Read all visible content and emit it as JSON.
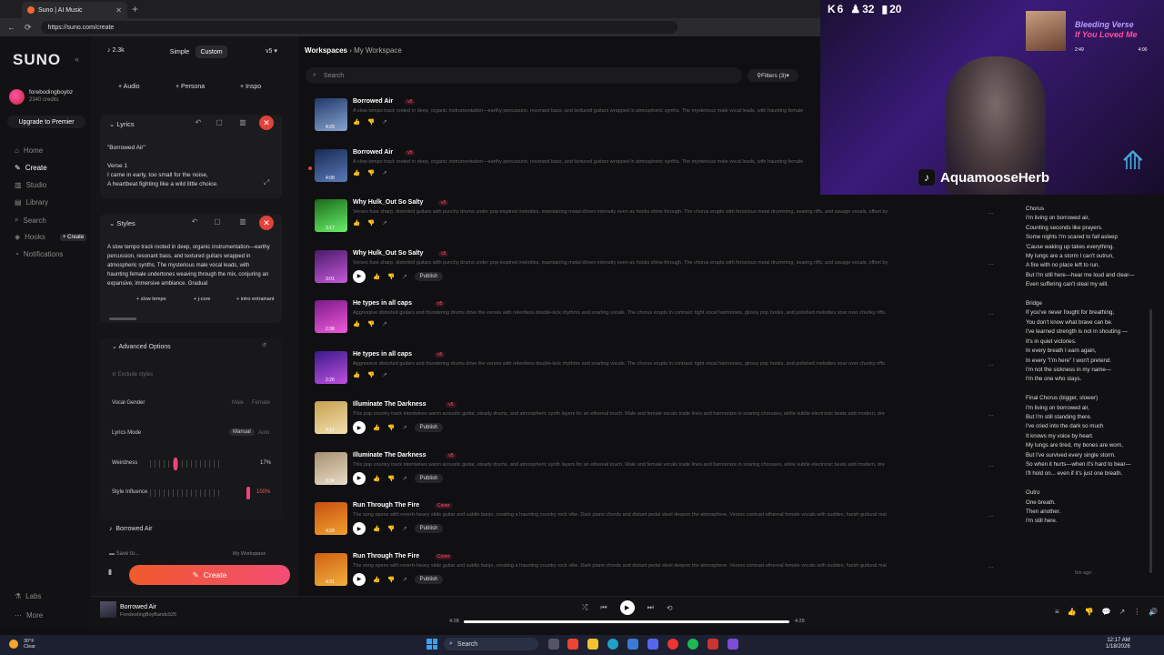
{
  "browser": {
    "tab_title": "Suno | AI Music",
    "url": "https://suno.com/create"
  },
  "nav": {
    "logo": "SUNO",
    "username": "forebodingboybz",
    "credits": "2340 credits",
    "upgrade": "Upgrade to Premier",
    "items": [
      "Home",
      "Create",
      "Studio",
      "Library",
      "Search",
      "Hooks",
      "Notifications"
    ],
    "create_tag": "+ Create",
    "bottom": [
      "Labs",
      "More"
    ]
  },
  "create": {
    "count": "2.3k",
    "modes": [
      "Simple",
      "Custom"
    ],
    "version": "v5",
    "add_buttons": [
      "+ Audio",
      "+ Persona",
      "+ Inspo"
    ],
    "lyrics_header": "Lyrics",
    "lyrics_text": "\"Borrowed Air\"\n\nVerse 1\nI came in early, too small for the noise,\nA heartbeat fighting like a wild little choice.",
    "styles_header": "Styles",
    "styles_text": "A slow tempo track rooted in deep, organic instrumentation—earthy percussion, resonant bass, and textured guitars wrapped in atmospheric synths. The mysterious male vocal leads, with haunting female undertones weaving through the mix, conjuring an expansive, immersive ambiance. Gradual",
    "style_chips": [
      "+ slow tempo",
      "+ j-core",
      "+ intro entrainant"
    ],
    "advanced": "Advanced Options",
    "exclude": "Exclude styles",
    "vocal_gender": "Vocal Gender",
    "vg_opts": [
      "Male",
      "Female"
    ],
    "lyrics_mode": "Lyrics Mode",
    "lm_opts": [
      "Manual",
      "Auto"
    ],
    "weirdness": "Weirdness",
    "weirdness_val": "17%",
    "weirdness_pct": 0.17,
    "style_influence": "Style Influence",
    "si_val": "100%",
    "si_pct": 1.0,
    "song_title": "Borrowed Air",
    "save_to": "Save to...",
    "workspace": "My Workspace",
    "create_btn": "Create"
  },
  "main": {
    "breadcrumb_root": "Workspaces",
    "breadcrumb_leaf": "My Workspace",
    "search_placeholder": "Search",
    "filters": "Filters (3)",
    "songs": [
      {
        "title": "Borrowed Air",
        "badge": "v5",
        "dur": "4:29",
        "desc": "A slow tempo track rooted in deep, organic instrumentation—earthy percussion, resonant bass, and textured guitars wrapped in atmospheric synths. The mysterious male vocal leads, with haunting female",
        "publish": false,
        "c1": "#1f3a6a",
        "c2": "#8aa4d0"
      },
      {
        "title": "Borrowed Air",
        "badge": "v5",
        "dur": "4:08",
        "desc": "A slow tempo track rooted in deep, organic instrumentation—earthy percussion, resonant bass, and textured guitars wrapped in atmospheric synths. The mysterious male vocal leads, with haunting female",
        "publish": false,
        "c1": "#182a52",
        "c2": "#5a7ab8"
      },
      {
        "title": "Why Hulk_Out So Salty",
        "badge": "v5",
        "dur": "3:17",
        "desc": "Verses fuse sharp, distorted guitars with punchy drums under pop-inspired melodies, maintaining metal-driven intensity even as hooks shine through. The chorus erupts with ferocious metal drumming, searing riffs, and savage vocals, offset by",
        "publish": false,
        "c1": "#1a6a1a",
        "c2": "#6af06a"
      },
      {
        "title": "Why Hulk_Out So Salty",
        "badge": "v5",
        "dur": "3:01",
        "desc": "Verses fuse sharp, distorted guitars with punchy drums under pop-inspired melodies, maintaining metal-driven intensity even as hooks shine through. The chorus erupts with ferocious metal drumming, searing riffs, and savage vocals, offset by",
        "publish": true,
        "c1": "#4a1a6a",
        "c2": "#c45ad8"
      },
      {
        "title": "He types in all caps",
        "badge": "v5",
        "dur": "2:38",
        "desc": "Aggressive distorted guitars and thundering drums drive the verses with relentless double-kick rhythms and snarling vocals. The chorus erupts in contrast: tight vocal harmonies, glossy pop hooks, and polished melodies soar over chunky riffs.",
        "publish": false,
        "c1": "#7a1a8a",
        "c2": "#f05ad8"
      },
      {
        "title": "He types in all caps",
        "badge": "v5",
        "dur": "2:26",
        "desc": "Aggressive distorted guitars and thundering drums drive the verses with relentless double-kick rhythms and snarling vocals. The chorus erupts in contrast: tight vocal harmonies, glossy pop hooks, and polished melodies soar over chunky riffs.",
        "publish": false,
        "c1": "#3a1a8a",
        "c2": "#c050e0"
      },
      {
        "title": "Illuminate The Darkness",
        "badge": "v5",
        "dur": "4:12",
        "desc": "This pop country track intertwines warm acoustic guitar, steady drums, and atmospheric synth layers for an ethereal touch. Male and female vocals trade lines and harmonize in soaring choruses, while subtle electronic beats add modern, dre",
        "publish": true,
        "c1": "#c8a050",
        "c2": "#f0e0b0"
      },
      {
        "title": "Illuminate The Darkness",
        "badge": "v5",
        "dur": "3:34",
        "desc": "This pop country track intertwines warm acoustic guitar, steady drums, and atmospheric synth layers for an ethereal touch. Male and female vocals trade lines and harmonize in soaring choruses, while subtle electronic beats add modern, dre",
        "publish": true,
        "c1": "#a89070",
        "c2": "#e8dcc8"
      },
      {
        "title": "Run Through The Fire",
        "badge": "Cover",
        "dur": "4:29",
        "desc": "The song opens with reverb-heavy slide guitar and subtle banjo, creating a haunting country rock vibe. Dark piano chords and distant pedal steel deepen the atmosphere. Verses contrast ethereal female vocals with sudden, harsh guttural mal",
        "publish": true,
        "c1": "#c85010",
        "c2": "#f0a030"
      },
      {
        "title": "Run Through The Fire",
        "badge": "Cover",
        "dur": "4:31",
        "desc": "The song opens with reverb-heavy slide guitar and subtle banjo, creating a haunting country rock vibe. Dark piano chords and distant pedal steel deepen the atmosphere. Verses contrast ethereal female vocals with sudden, harsh guttural mal",
        "publish": true,
        "c1": "#d06010",
        "c2": "#f0b040"
      }
    ],
    "publish_label": "Publish"
  },
  "lyrics_panel": {
    "text": "Chorus\nI'm living on borrowed air,\nCounting seconds like prayers.\nSome nights I'm scared to fall asleep\n'Cause waking up takes everything.\nMy lungs are a storm I can't outrun,\nA fire with no place left to run.\nBut I'm still here—hear me loud and clear—\nEven suffering can't steal my will.\n\nBridge\nIf you've never fought for breathing,\nYou don't know what brave can be.\nI've learned strength is not in shouting —\nIt's in quiet victories.\nIn every breath I earn again,\nIn every \"I'm here\" I won't pretend.\nI'm not the sickness in my name—\nI'm the one who stays.\n\nFinal Chorus (bigger, slower)\nI'm living on borrowed air,\nBut I'm still standing there.\nI've cried into the dark so much\nIt knows my voice by heart.\nMy lungs are tired, my bones are worn,\nBut I've survived every single storm.\nSo when it hurts—when it's hard to bear—\nI'll hold on... even if it's just one breath.\n\nOutro\nOne breath.\nThen another.\nI'm still here.",
    "time": "5m ago"
  },
  "stream": {
    "stat1": "6",
    "stat2": "32",
    "stat3": "20",
    "now_title": "Bleeding Verse",
    "now_sub": "If You Loved Me",
    "now_t1": "2:49",
    "now_t2": "4:00",
    "handle": "AquamooseHerb"
  },
  "player": {
    "title": "Borrowed Air",
    "artist": "ForebodingBoyBands925",
    "t1": "4:28",
    "t2": "4:29"
  },
  "taskbar": {
    "weather_temp": "30°F",
    "weather_cond": "Clear",
    "search": "Search",
    "time": "12:17 AM",
    "date": "1/18/2026"
  }
}
